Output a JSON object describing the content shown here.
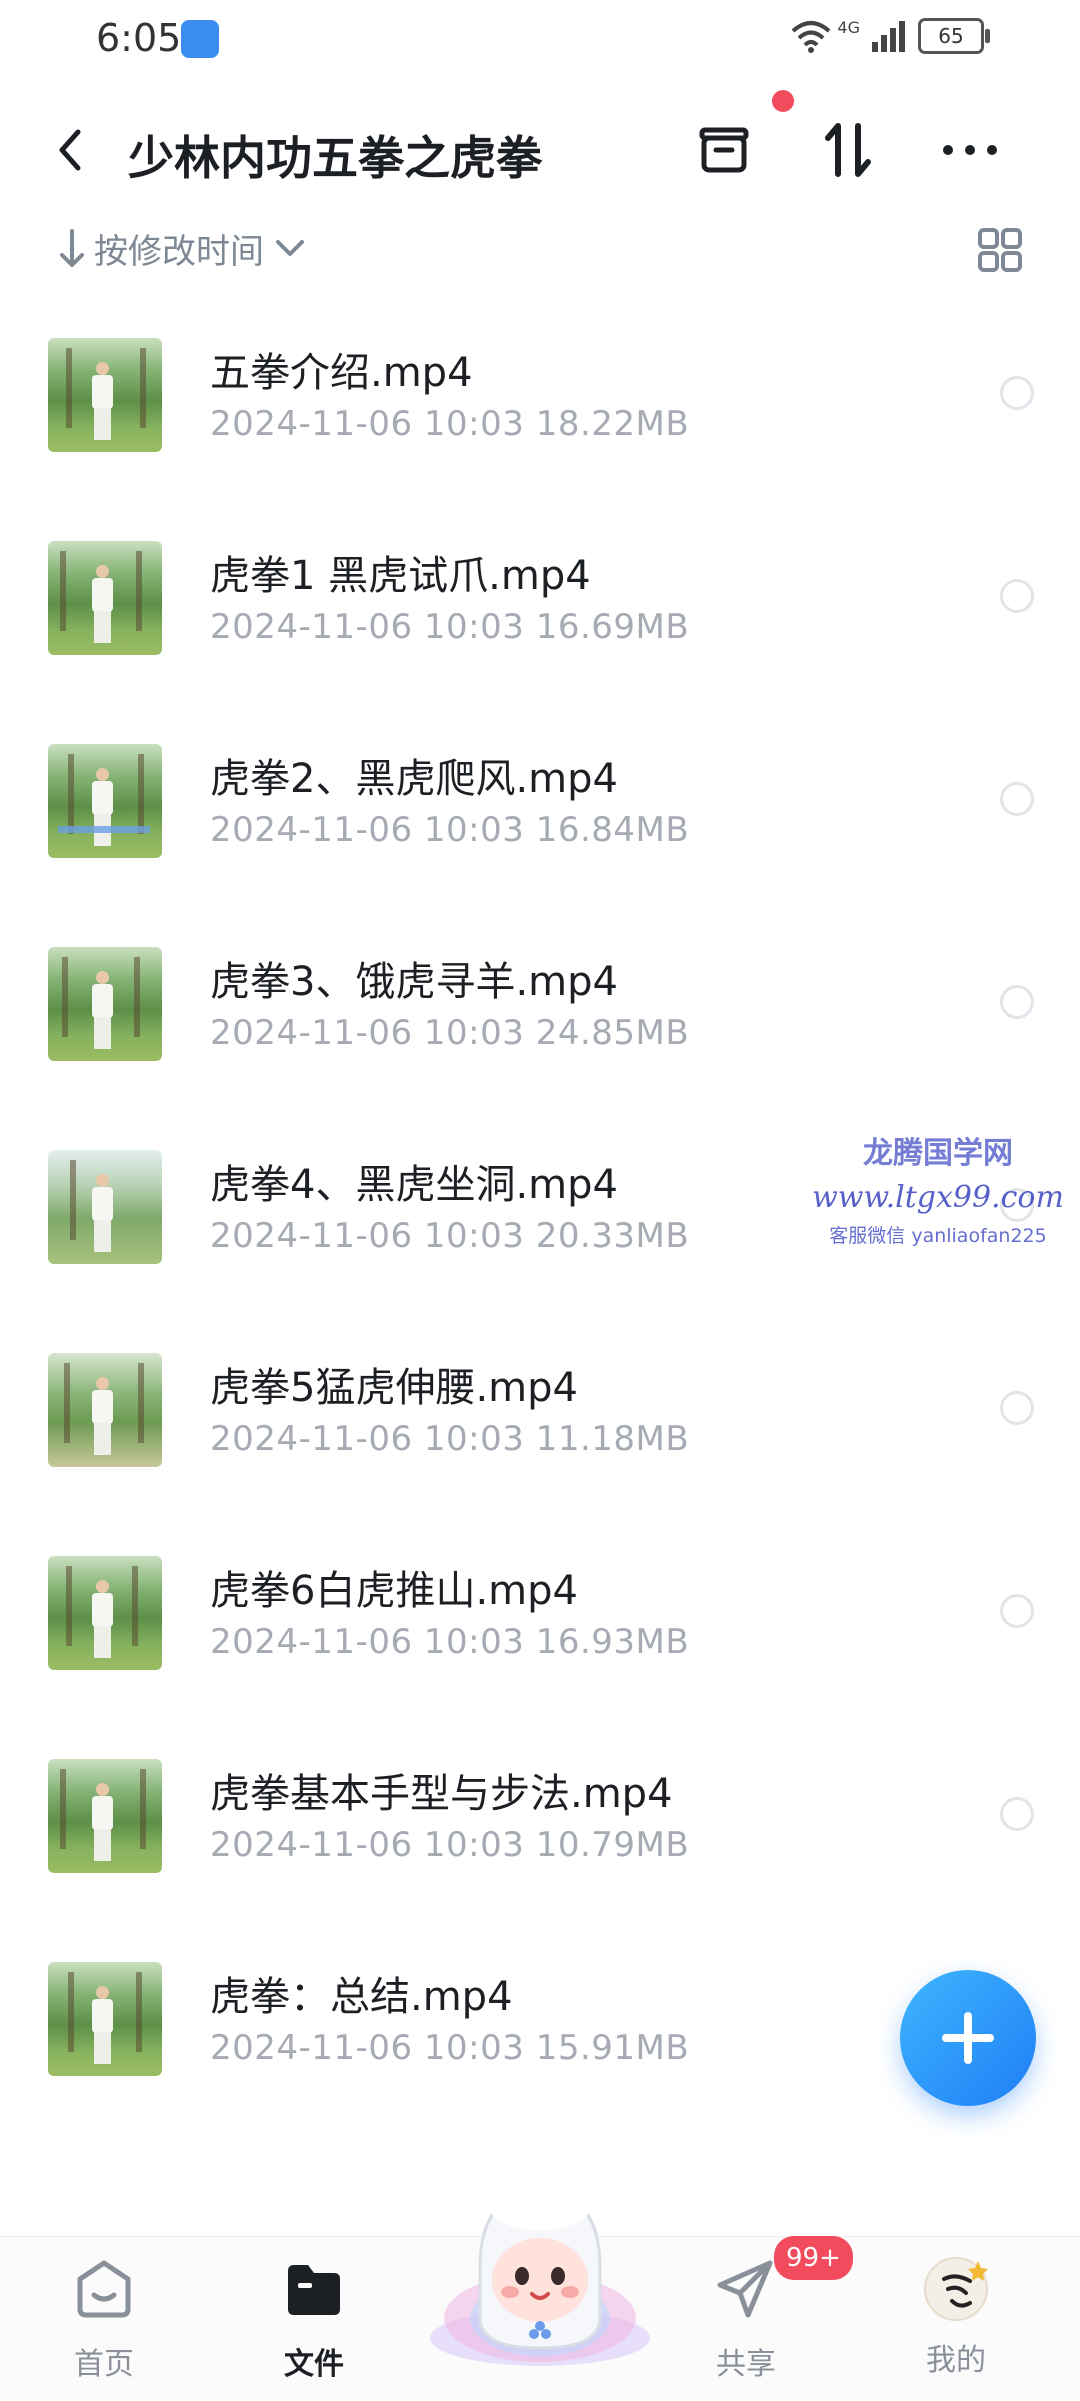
{
  "status_bar": {
    "time": "6:05",
    "network": "4G",
    "battery": "65"
  },
  "header": {
    "title": "少林内功五拳之虎拳"
  },
  "sort": {
    "label": "按修改时间"
  },
  "files": [
    {
      "name": "五拳介绍.mp4",
      "meta": "2024-11-06  10:03  18.22MB"
    },
    {
      "name": "虎拳1 黑虎试爪.mp4",
      "meta": "2024-11-06  10:03  16.69MB"
    },
    {
      "name": "虎拳2、黑虎爬风.mp4",
      "meta": "2024-11-06  10:03  16.84MB"
    },
    {
      "name": "虎拳3、饿虎寻羊.mp4",
      "meta": "2024-11-06  10:03  24.85MB"
    },
    {
      "name": "虎拳4、黑虎坐洞.mp4",
      "meta": "2024-11-06  10:03  20.33MB"
    },
    {
      "name": "虎拳5猛虎伸腰.mp4",
      "meta": "2024-11-06  10:03  11.18MB"
    },
    {
      "name": "虎拳6白虎推山.mp4",
      "meta": "2024-11-06  10:03  16.93MB"
    },
    {
      "name": "虎拳基本手型与步法.mp4",
      "meta": "2024-11-06  10:03  10.79MB"
    },
    {
      "name": "虎拳：总结.mp4",
      "meta": "2024-11-06  10:03  15.91MB"
    }
  ],
  "watermark": {
    "line1": "龙腾国学网",
    "line2": "www.ltgx99.com",
    "line3": "客服微信 yanliaofan225"
  },
  "bottom_nav": {
    "home": "首页",
    "files": "文件",
    "share": "共享",
    "share_badge": "99+",
    "mine": "我的"
  },
  "colors": {
    "accent": "#1e7ef5",
    "badge": "#f24b5e",
    "meta_text": "#a5aab3"
  }
}
